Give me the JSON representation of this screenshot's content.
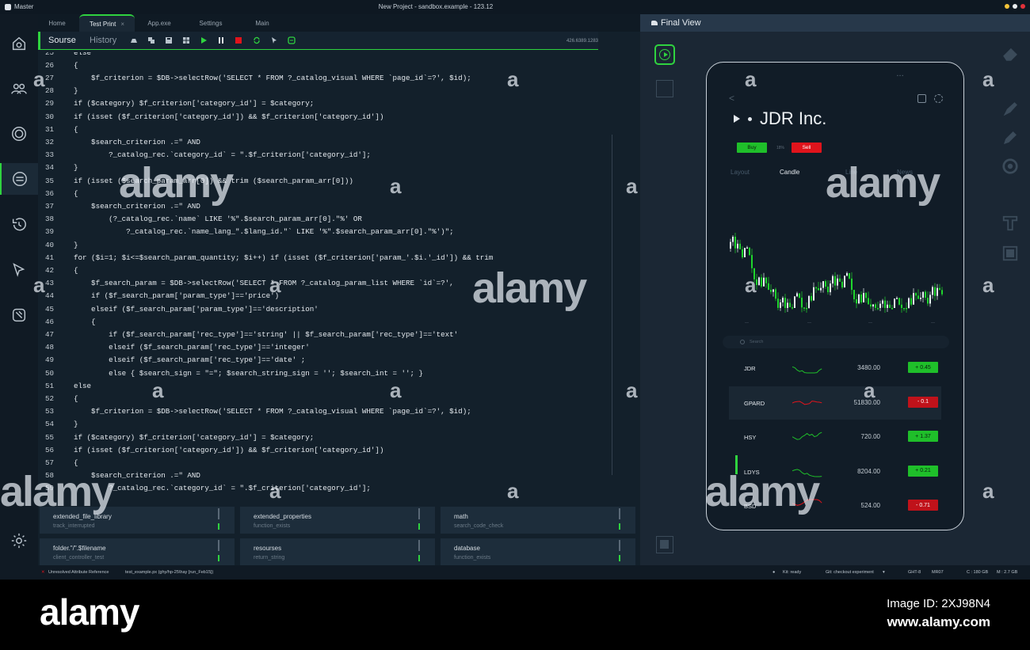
{
  "titlebar": {
    "app": "Master",
    "title": "New Project - sandbox.example - 123.12"
  },
  "tabs": [
    {
      "label": "Home"
    },
    {
      "label": "Test Print",
      "close": "×"
    },
    {
      "label": "App.exe"
    },
    {
      "label": "Settings"
    },
    {
      "label": "Main"
    }
  ],
  "toolbar": {
    "source_label": "Sourse",
    "history_label": "History",
    "coords": "426.6389.1283"
  },
  "code_lines": [
    {
      "n": "25",
      "t": "else"
    },
    {
      "n": "26",
      "t": "{"
    },
    {
      "n": "27",
      "t": "    $f_criterion = $DB->selectRow('SELECT * FROM ?_catalog_visual WHERE `page_id`=?', $id);"
    },
    {
      "n": "28",
      "t": "}"
    },
    {
      "n": "29",
      "t": "if ($category) $f_criterion['category_id'] = $category;"
    },
    {
      "n": "30",
      "t": "if (isset ($f_criterion['category_id']) && $f_criterion['category_id'])"
    },
    {
      "n": "31",
      "t": "{"
    },
    {
      "n": "32",
      "t": "    $search_criterion .=\" AND"
    },
    {
      "n": "33",
      "t": "        ?_catalog_rec.`category_id` = \".$f_criterion['category_id'];"
    },
    {
      "n": "34",
      "t": "}"
    },
    {
      "n": "35",
      "t": "if (isset ($search_param_arr[0]) && trim ($search_param_arr[0]))"
    },
    {
      "n": "36",
      "t": "{"
    },
    {
      "n": "37",
      "t": "    $search_criterion .=\" AND"
    },
    {
      "n": "38",
      "t": "        (?_catalog_rec.`name` LIKE '%\".$search_param_arr[0].\"%' OR"
    },
    {
      "n": "39",
      "t": "            ?_catalog_rec.`name_lang_\".$lang_id.\"` LIKE '%\".$search_param_arr[0].\"%')\";"
    },
    {
      "n": "40",
      "t": "}"
    },
    {
      "n": "41",
      "t": "for ($i=1; $i<=$search_param_quantity; $i++) if (isset ($f_criterion['param_'.$i.'_id']) && trim"
    },
    {
      "n": "42",
      "t": "{"
    },
    {
      "n": "43",
      "t": "    $f_search_param = $DB->selectRow('SELECT * FROM ?_catalog_param_list WHERE `id`=?',"
    },
    {
      "n": "44",
      "t": "    if ($f_search_param['param_type']=='price')"
    },
    {
      "n": "45",
      "t": "    elseif ($f_search_param['param_type']=='description'"
    },
    {
      "n": "46",
      "t": "    {"
    },
    {
      "n": "47",
      "t": "        if ($f_search_param['rec_type']=='string' || $f_search_param['rec_type']=='text'"
    },
    {
      "n": "48",
      "t": "        elseif ($f_search_param['rec_type']=='integer'"
    },
    {
      "n": "49",
      "t": "        elseif ($f_search_param['rec_type']=='date' ;"
    },
    {
      "n": "50",
      "t": "        else { $search_sign = \"=\"; $search_string_sign = ''; $search_int = ''; }"
    },
    {
      "n": "51",
      "t": "else"
    },
    {
      "n": "52",
      "t": "{"
    },
    {
      "n": "53",
      "t": "    $f_criterion = $DB->selectRow('SELECT * FROM ?_catalog_visual WHERE `page_id`=?', $id);"
    },
    {
      "n": "54",
      "t": "}"
    },
    {
      "n": "55",
      "t": "if ($category) $f_criterion['category_id'] = $category;"
    },
    {
      "n": "56",
      "t": "if (isset ($f_criterion['category_id']) && $f_criterion['category_id'])"
    },
    {
      "n": "57",
      "t": "{"
    },
    {
      "n": "58",
      "t": "    $search_criterion .=\" AND"
    },
    {
      "n": "59",
      "t": "        ?_catalog_rec.`category_id` = \".$f_criterion['category_id'];"
    }
  ],
  "cards": [
    {
      "title": "extended_file_library",
      "sub": "track_interrupted"
    },
    {
      "title": "extended_properties",
      "sub": "function_exists"
    },
    {
      "title": "math",
      "sub": "search_code_check"
    },
    {
      "title": "folder.\"/\".$filename",
      "sub": "client_controller_test"
    },
    {
      "title": "resourses",
      "sub": "return_string"
    },
    {
      "title": "database",
      "sub": "function_exists"
    }
  ],
  "status": {
    "error": "Unresolved Attribute Reference",
    "file": "test_example.px (ghy/hp-25\\hay [run_Feb15])",
    "kit": "Kit: ready",
    "git": "Git: checkout experiment",
    "ght": "GHT-8",
    "mr": "MR07",
    "c": "C : 180 GB",
    "m": "M : 2.7 GB"
  },
  "right": {
    "title": "Final View",
    "company": "JDR Inc.",
    "buy": "Buy",
    "sell": "Sell",
    "pct": "18%",
    "chart_tabs": [
      "Layout",
      "Candle",
      "Line",
      "News"
    ],
    "search_placeholder": "Search",
    "stocks": [
      {
        "ticker": "JDR",
        "price": "3480.00",
        "change": "+ 0.45",
        "up": true
      },
      {
        "ticker": "GPARD",
        "price": "51830.00",
        "change": "- 0.1",
        "up": false
      },
      {
        "ticker": "HSY",
        "price": "720.00",
        "change": "+ 1.37",
        "up": true
      },
      {
        "ticker": "LDYS",
        "price": "8204.00",
        "change": "+ 0.21",
        "up": true
      },
      {
        "ticker": "BSD",
        "price": "524.00",
        "change": "- 0.71",
        "up": false
      }
    ]
  },
  "colors": {
    "accent": "#2fd33f",
    "down": "#e0141c",
    "up": "#1fbf2a"
  },
  "footer": {
    "brand": "alamy",
    "image_id": "Image ID: 2XJ98N4",
    "site": "www.alamy.com"
  },
  "watermark": {
    "big": "alamy",
    "small": "a"
  }
}
